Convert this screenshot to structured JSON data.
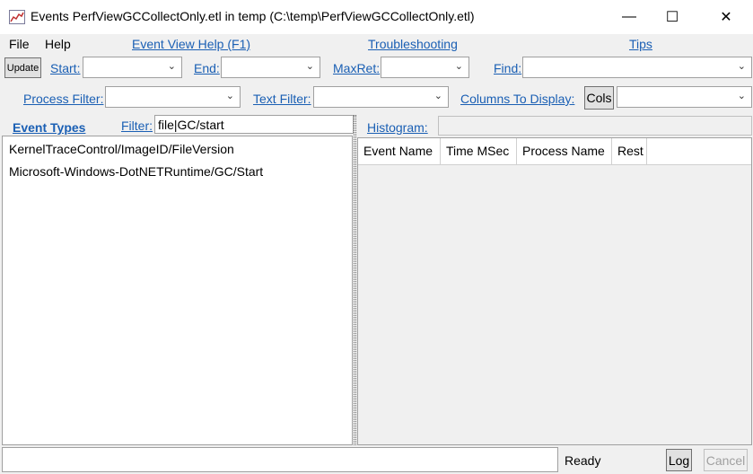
{
  "window": {
    "title": "Events PerfViewGCCollectOnly.etl in temp (C:\\temp\\PerfViewGCCollectOnly.etl)",
    "controls": {
      "minimize": "—",
      "maximize": "☐",
      "close": "✕"
    }
  },
  "menu": {
    "file": "File",
    "help": "Help"
  },
  "links": {
    "event_view_help": "Event View Help (F1)",
    "troubleshooting": "Troubleshooting",
    "tips": "Tips"
  },
  "toolbar": {
    "update_label": "Update",
    "start_label": "Start:",
    "end_label": "End:",
    "maxret_label": "MaxRet:",
    "find_label": "Find:",
    "process_filter_label": "Process Filter:",
    "text_filter_label": "Text Filter:",
    "columns_label": "Columns To Display:",
    "cols_button": "Cols"
  },
  "left": {
    "event_types_label": "Event Types",
    "filter_label": "Filter:",
    "filter_value": "file|GC/start",
    "items": [
      "KernelTraceControl/ImageID/FileVersion",
      "Microsoft-Windows-DotNETRuntime/GC/Start"
    ]
  },
  "right": {
    "histogram_label": "Histogram:",
    "columns": [
      "Event Name",
      "Time MSec",
      "Process Name",
      "Rest"
    ]
  },
  "status": {
    "text": "Ready",
    "log_button": "Log",
    "cancel_button": "Cancel"
  }
}
